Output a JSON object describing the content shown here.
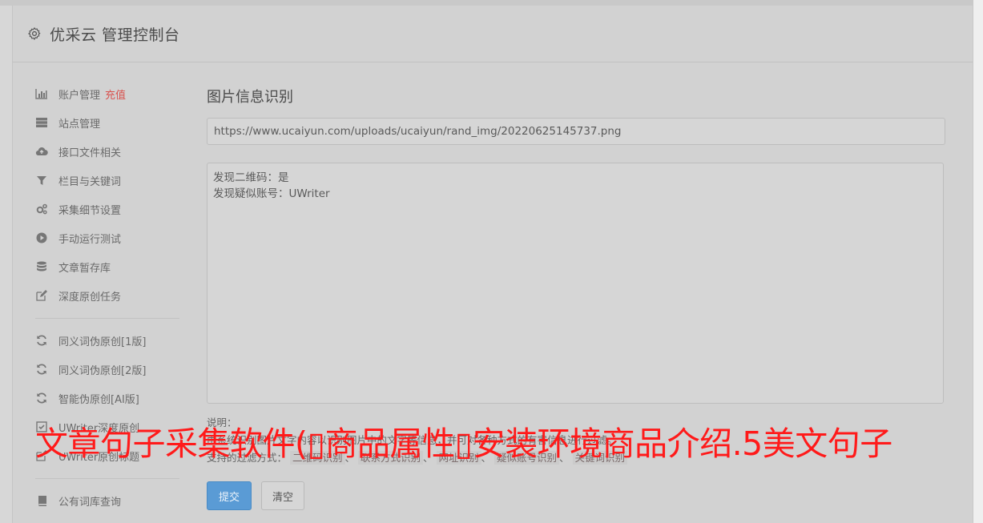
{
  "header": {
    "title": "优采云 管理控制台"
  },
  "sidebar": {
    "group1": [
      {
        "label": "账户管理",
        "badge": "充值",
        "icon": "bar-chart-icon"
      },
      {
        "label": "站点管理",
        "icon": "server-icon"
      },
      {
        "label": "接口文件相关",
        "icon": "cloud-upload-icon"
      },
      {
        "label": "栏目与关键词",
        "icon": "filter-icon"
      },
      {
        "label": "采集细节设置",
        "icon": "gears-icon"
      },
      {
        "label": "手动运行测试",
        "icon": "play-circle-icon"
      },
      {
        "label": "文章暂存库",
        "icon": "database-icon"
      },
      {
        "label": "深度原创任务",
        "icon": "edit-icon"
      }
    ],
    "group2": [
      {
        "label": "同义词伪原创[1版]",
        "icon": "refresh-icon"
      },
      {
        "label": "同义词伪原创[2版]",
        "icon": "refresh-icon"
      },
      {
        "label": "智能伪原创[AI版]",
        "icon": "refresh-icon"
      },
      {
        "label": "UWriter深度原创",
        "icon": "check-square-icon"
      },
      {
        "label": "UWriter原创标题",
        "icon": "edit-icon"
      }
    ],
    "group3": [
      {
        "label": "公有词库查询",
        "icon": "book-icon"
      }
    ]
  },
  "main": {
    "title": "图片信息识别",
    "url_value": "https://www.ucaiyun.com/uploads/ucaiyun/rand_img/20220625145737.png",
    "result_lines": [
      "发现二维码：是",
      "发现疑似账号：UWriter"
    ],
    "note_label": "说明：",
    "note_desc": "由系统识别图片文字内容以识别图片中的文字等信息，并可对各种方式的有害信息进行过滤。",
    "filter_label": "支持的过滤方式：",
    "filters": [
      "二维码识别",
      "联系方式识别",
      "网址识别",
      "疑似账号识别",
      "关键词识别"
    ],
    "submit_label": "提交",
    "clear_label": "清空"
  },
  "watermark": "文章句子采集软件(▯商品属性▯安装环境商品介绍.5美文句子",
  "colors": {
    "accent": "#5a9bd5",
    "badge": "#d9534f",
    "watermark": "#ff1a1a"
  }
}
